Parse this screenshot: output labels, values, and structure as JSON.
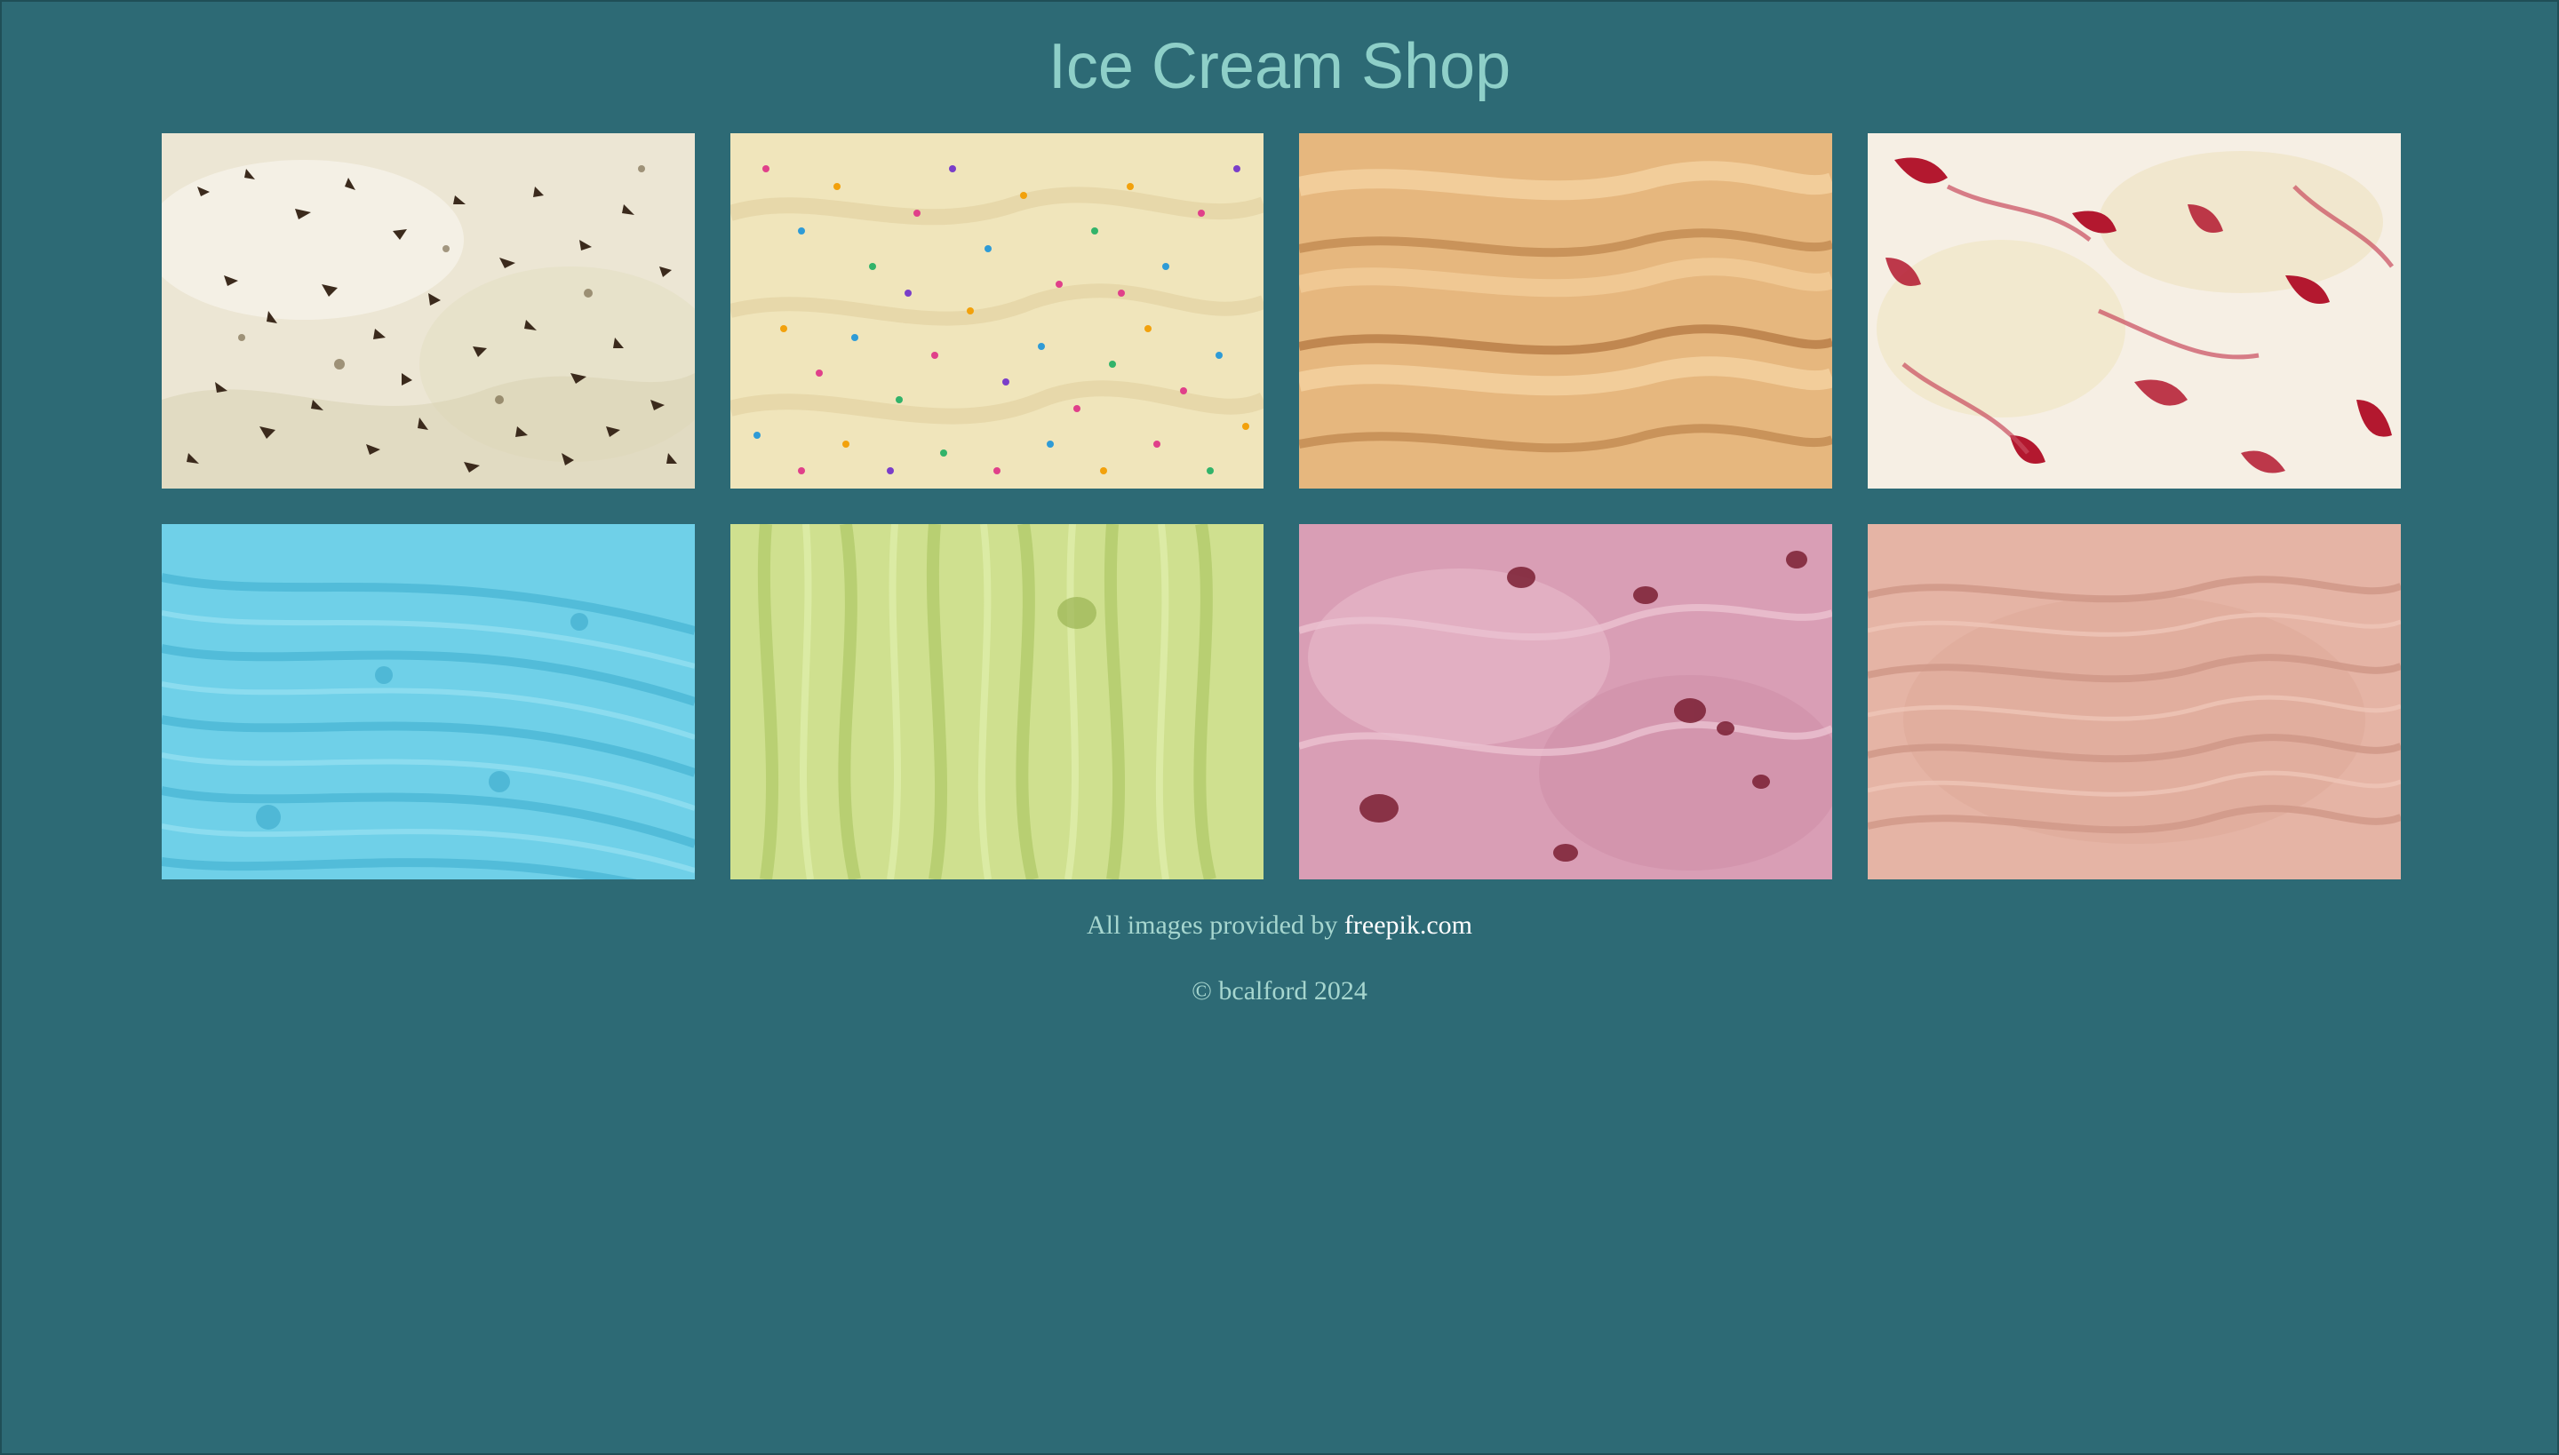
{
  "page": {
    "title": "Ice Cream Shop",
    "background_color": "#2d6a75",
    "title_color": "#8ecfc8"
  },
  "gallery": [
    {
      "flavor_visual": "cookies-and-cream",
      "base_color": "#efeadb",
      "accent_color": "#3b2a1c"
    },
    {
      "flavor_visual": "vanilla-with-sprinkles",
      "base_color": "#f1e6bd",
      "accent_color": "#e0408a"
    },
    {
      "flavor_visual": "peanut-butter",
      "base_color": "#e8bb84",
      "accent_color": "#b88550"
    },
    {
      "flavor_visual": "cherry-swirl",
      "base_color": "#f5eee6",
      "accent_color": "#b3182f"
    },
    {
      "flavor_visual": "blue-raspberry",
      "base_color": "#6fd0e8",
      "accent_color": "#3aa9c9"
    },
    {
      "flavor_visual": "pistachio",
      "base_color": "#cfe08f",
      "accent_color": "#a4bf5e"
    },
    {
      "flavor_visual": "black-cherry",
      "base_color": "#d99eb5",
      "accent_color": "#7a1f33"
    },
    {
      "flavor_visual": "chocolate-milk",
      "base_color": "#e5b4a5",
      "accent_color": "#b98575"
    }
  ],
  "footer": {
    "credit_prefix": "All images provided by ",
    "credit_link": "freepik.com",
    "copyright": "© bcalford 2024"
  }
}
